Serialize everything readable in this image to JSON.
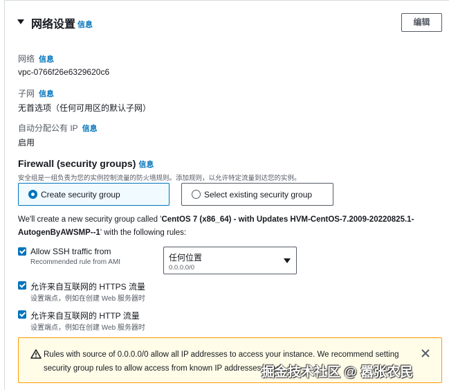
{
  "header": {
    "title": "网络设置",
    "info": "信息",
    "edit_button": "编辑"
  },
  "network": {
    "label": "网络",
    "info": "信息",
    "value": "vpc-0766f26e6329620c6"
  },
  "subnet": {
    "label": "子网",
    "info": "信息",
    "value": "无首选项（任何可用区的默认子网）"
  },
  "public_ip": {
    "label": "自动分配公有 IP",
    "info": "信息",
    "value": "启用"
  },
  "firewall": {
    "title": "Firewall (security groups)",
    "info": "信息",
    "description": "安全组是一组负责为您的实例控制流量的防火墙规则。添加规则，以允许特定流量到达您的实例。",
    "options": [
      {
        "label": "Create security group",
        "selected": true
      },
      {
        "label": "Select existing security group",
        "selected": false
      }
    ],
    "note_prefix": "We'll create a new security group called '",
    "note_name": "CentOS 7 (x86_64) - with Updates HVM-CentOS-7.2009-20220825.1-AutogenByAWSMP--1",
    "note_suffix": "' with the following rules:"
  },
  "rules": [
    {
      "title": "Allow SSH traffic from",
      "subtitle": "Recommended rule from AMI",
      "checked": true
    },
    {
      "title": "允许来自互联网的 HTTPS 流量",
      "subtitle": "设置端点，例如在创建 Web 服务器时",
      "checked": true
    },
    {
      "title": "允许来自互联网的 HTTP 流量",
      "subtitle": "设置端点，例如在创建 Web 服务器时",
      "checked": true
    }
  ],
  "ssh_source": {
    "value": "任何位置",
    "sub": "0.0.0.0/0"
  },
  "warning": {
    "text": "Rules with source of 0.0.0.0/0 allow all IP addresses to access your instance. We recommend setting security group rules to allow access from known IP addresses only."
  },
  "watermark": "掘金技术社区 @ 嚣张农民",
  "colors": {
    "accent": "#0073bb",
    "warning_border": "#ff9900",
    "warning_bg": "#fffce8"
  }
}
